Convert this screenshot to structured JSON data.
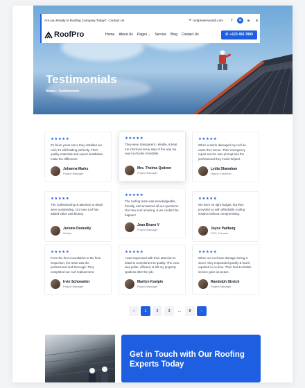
{
  "topbar": {
    "tagline": "Are you Ready to Roofing Company Today?",
    "contact_link": "Contact Us",
    "email": "roofproservice@.com",
    "socials": [
      "f",
      "◎",
      "in",
      "X"
    ]
  },
  "navbar": {
    "brand": "RoofPro",
    "links": [
      "Home",
      "About Us",
      "Pages",
      "Service",
      "Blog",
      "Contact Us"
    ],
    "phone": "+123 456 7890"
  },
  "hero": {
    "title": "Testimonials",
    "breadcrumb_home": "Home",
    "breadcrumb_sep": "›",
    "breadcrumb_current": "Testimonials"
  },
  "testimonials": [
    {
      "stars": "★★★★★",
      "quote": "It's been years since they installed our roof; it's still holding perfectly. Their quality materials and expert installation make the difference.",
      "name": "Johanna Marks",
      "role": "Project Manager"
    },
    {
      "stars": "★★★★★",
      "quote": "They were transparent, reliable, & kept me informed every step of the way my new roof looks incredible.",
      "name": "Mrs. Thelma Quitzon",
      "role": "Project Manager"
    },
    {
      "stars": "★★★★★",
      "quote": "When a storm damaged my roof an came the rescue. Their emergency repair service was prompt and the professional they invisit helped.",
      "name": "Lydia Shanahan",
      "role": "Happy Customer"
    },
    {
      "stars": "★★★★★",
      "quote": "The craftsmanship & attention to detail were outstanding. Our new roof has added value and beauty.",
      "name": "Jerome Donnelly",
      "role": "Worker"
    },
    {
      "stars": "★★★★★",
      "quote": "The roofing team was knowledgeable, friendly, and answered all our questions. Our new roof amazing, & we couldn't be happier!",
      "name": "Jean Bruen V",
      "role": "Project Manager"
    },
    {
      "stars": "★★★★★",
      "quote": "We were on tight budget, but they provided us with affordable roofing solution without compromising.",
      "name": "Joyce Padberg",
      "role": "CEO, Founder"
    },
    {
      "stars": "★★★★★",
      "quote": "From the first consultation to the final inspection, the team was the professional and thorough. They completed our roof replacement.",
      "name": "Irvin Schowalter",
      "role": "Project Manager"
    },
    {
      "stars": "★★★★★",
      "quote": "I was impressed with their attention to detail & commitment to quality. The crew was polite, efficient, & left my property spotless after the job.",
      "name": "Marilyn Koelpin",
      "role": "Project Manager"
    },
    {
      "stars": "★★★★★",
      "quote": "When our roof was damage during a storm, they responded quickly & had it repaired in no time. Their fast & reliable service gave us peace.",
      "name": "Randolph Streich",
      "role": "Project Manager"
    }
  ],
  "pagination": {
    "prev": "‹",
    "pages": [
      "1",
      "2",
      "3"
    ],
    "ellipsis": "...",
    "last": "8",
    "next": "›",
    "current": "1"
  },
  "cta": {
    "title": "Get in Touch with Our Roofing Experts Today"
  },
  "colors": {
    "accent": "#1d5fe0"
  }
}
